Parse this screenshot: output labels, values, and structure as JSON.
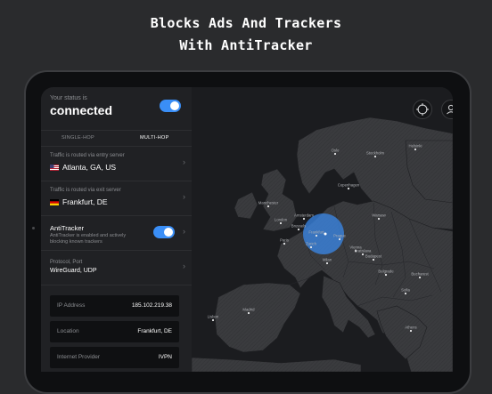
{
  "headline": {
    "line1": "Blocks Ads And Trackers",
    "line2": "With AntiTracker"
  },
  "status": {
    "label": "Your status is",
    "value": "connected",
    "toggle_on": true
  },
  "tabs": [
    {
      "label": "SINGLE-HOP",
      "active": false
    },
    {
      "label": "MULTI-HOP",
      "active": true
    }
  ],
  "entry": {
    "label": "Traffic is routed via entry server",
    "value": "Atlanta, GA, US",
    "flag": "us-flag"
  },
  "exit": {
    "label": "Traffic is routed via exit server",
    "value": "Frankfurt, DE",
    "flag": "de-flag"
  },
  "antitracker": {
    "title": "AntiTracker",
    "desc1": "AntiTracker is enabled and actively",
    "desc2": "blocking known trackers",
    "toggle_on": true
  },
  "protocol": {
    "label": "Protocol, Port",
    "value": "WireGuard, UDP"
  },
  "info": [
    {
      "key": "IP Address",
      "value": "185.102.219.38"
    },
    {
      "key": "Location",
      "value": "Frankfurt, DE"
    },
    {
      "key": "Internet Provider",
      "value": "IVPN"
    }
  ],
  "map": {
    "icons": [
      "locate-icon",
      "account-icon",
      "settings-icon"
    ],
    "cities": [
      "Oslo",
      "Stockholm",
      "Helsinki",
      "Copenhagen",
      "Manchester",
      "London",
      "Amsterdam",
      "Brussels",
      "Frankfurt",
      "Zurich",
      "Paris",
      "Prague",
      "Warsaw",
      "Vienna",
      "Bratislava",
      "Budapest",
      "Milan",
      "Belgrade",
      "Bucharest",
      "Sofia",
      "Madrid",
      "Lisbon",
      "Athens"
    ],
    "highlight_color": "#3a8ef6"
  }
}
